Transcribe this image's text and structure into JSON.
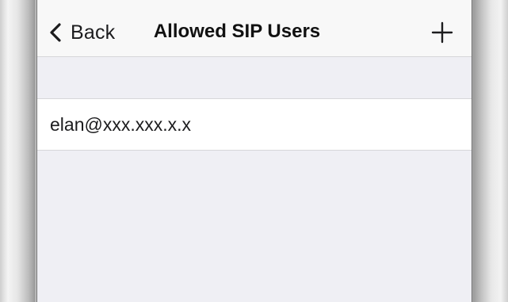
{
  "navbar": {
    "back_label": "Back",
    "title": "Allowed SIP Users",
    "add_icon": "plus-icon",
    "back_icon": "chevron-left-icon"
  },
  "users": [
    {
      "address": "elan@xxx.xxx.x.x"
    }
  ],
  "colors": {
    "navbar_bg": "#f8f8f8",
    "screen_bg": "#efeff4",
    "row_bg": "#ffffff",
    "separator": "#d6d6d9",
    "text": "#1c1c1e"
  }
}
